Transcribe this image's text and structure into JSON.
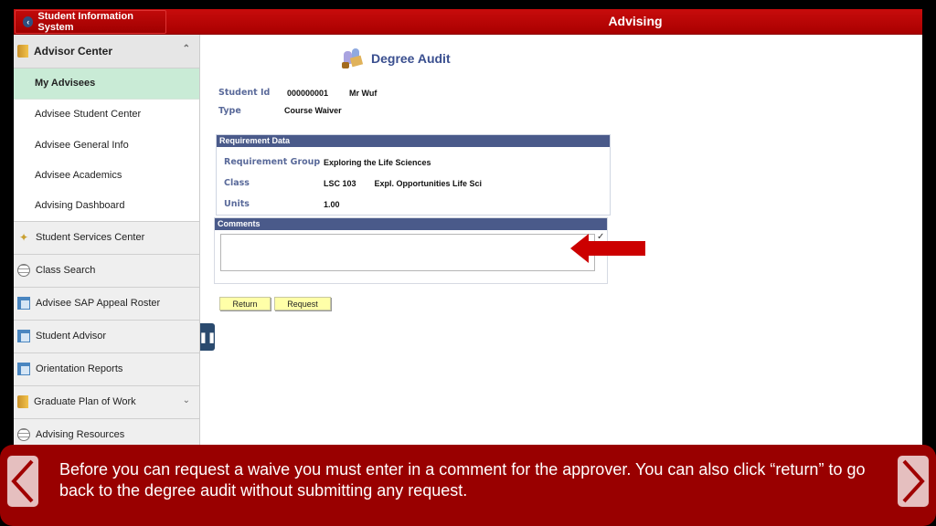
{
  "header": {
    "home_label": "Student Information System",
    "title": "Advising"
  },
  "sidebar": {
    "advisor_center": {
      "label": "Advisor Center",
      "icon": "folder-icon",
      "expanded": true,
      "items": [
        {
          "label": "My Advisees",
          "active": true
        },
        {
          "label": "Advisee Student Center"
        },
        {
          "label": "Advisee General Info"
        },
        {
          "label": "Advisee Academics"
        },
        {
          "label": "Advising Dashboard"
        }
      ]
    },
    "items": [
      {
        "label": "Student Services Center",
        "icon": "wand-icon"
      },
      {
        "label": "Class Search",
        "icon": "globe-icon"
      },
      {
        "label": "Advisee SAP Appeal Roster",
        "icon": "page-icon"
      },
      {
        "label": "Student Advisor",
        "icon": "page-icon"
      },
      {
        "label": "Orientation Reports",
        "icon": "page-icon"
      },
      {
        "label": "Graduate Plan of Work",
        "icon": "folder-icon",
        "has_chevron": true
      },
      {
        "label": "Advising Resources",
        "icon": "globe-icon"
      }
    ]
  },
  "main": {
    "title": "Degree Audit",
    "student_id_label": "Student Id",
    "student_id": "000000001",
    "student_name": "Mr Wuf",
    "type_label": "Type",
    "type_value": "Course Waiver",
    "requirement_data": {
      "header": "Requirement Data",
      "group_label": "Requirement Group",
      "group_value": "Exploring the Life Sciences",
      "class_label": "Class",
      "class_code": "LSC 103",
      "class_title": "Expl. Opportunities Life Sci",
      "units_label": "Units",
      "units_value": "1.00"
    },
    "comments": {
      "header": "Comments",
      "value": ""
    },
    "buttons": {
      "return": "Return",
      "request": "Request"
    },
    "annotation_color": "#cc0000"
  },
  "overlay": {
    "caption": "Before you can request a waive you must enter in a comment for the approver. You can also click “return” to go back to the degree audit without submitting any request.",
    "background": "#990000"
  }
}
